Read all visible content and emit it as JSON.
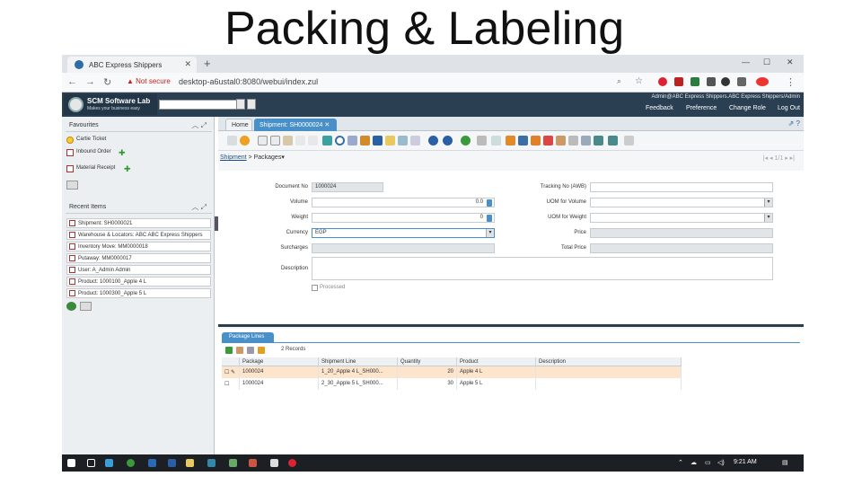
{
  "slide_title": "Packing & Labeling",
  "browser": {
    "tab_title": "ABC Express Shippers",
    "security_label": "Not secure",
    "url": "desktop-a6ustal0:8080/webui/index.zul",
    "colors": {
      "tabstrip": "#dfe3e7",
      "addrbar": "#f8f9fa",
      "warn": "#c5221f"
    }
  },
  "app": {
    "logo_name": "SCM Software Lab",
    "logo_tagline": "Makes your business easy",
    "user_line": "Admin@ABC Express Shippers.ABC Express Shippers/Admin",
    "header_links": [
      "Feedback",
      "Preference",
      "Change Role",
      "Log Out"
    ],
    "header_color": "#2a3f52",
    "accent": "#4a90c8"
  },
  "favourites": {
    "title": "Favourites",
    "items": [
      "Cartie Ticket",
      "Inbound Order",
      "Material Receipt"
    ]
  },
  "recent": {
    "title": "Recent Items",
    "items": [
      "Shipment: SH0000021",
      "Warehouse & Locators: ABC ABC Express Shippers",
      "Inventory Move: MM0000018",
      "Putaway: MM0000017",
      "User: A_Admin Admin",
      "Product: 1000100_Apple 4 L",
      "Product: 1000300_Apple 5 L"
    ]
  },
  "tabs": {
    "home": "Home",
    "active": "Shipment: SH0000024"
  },
  "breadcrumb": {
    "parent": "Shipment",
    "current": "Packages"
  },
  "pager": "1/1",
  "form": {
    "document_no": {
      "label": "Document No",
      "value": "1000024"
    },
    "volume": {
      "label": "Volume",
      "value": "0.0"
    },
    "weight": {
      "label": "Weight",
      "value": "0"
    },
    "currency": {
      "label": "Currency",
      "value": "EGP"
    },
    "surcharges": {
      "label": "Surcharges",
      "value": ""
    },
    "description": {
      "label": "Description",
      "value": ""
    },
    "processed": {
      "label": "Processed"
    },
    "tracking_no": {
      "label": "Tracking No (AWB)",
      "value": ""
    },
    "uom_volume": {
      "label": "UOM for Volume",
      "value": ""
    },
    "uom_weight": {
      "label": "UOM for Weight",
      "value": ""
    },
    "price": {
      "label": "Price",
      "value": ""
    },
    "total_price": {
      "label": "Total Price",
      "value": ""
    }
  },
  "package_lines": {
    "tab_title": "Package Lines",
    "records": "2 Records",
    "columns": [
      "Package",
      "Shipment Line",
      "Quantity",
      "Product",
      "Description"
    ],
    "rows": [
      {
        "package": "1000024",
        "shipment_line": "1_20_Apple 4 L_SH000...",
        "quantity": "20",
        "product": "Apple 4 L",
        "description": ""
      },
      {
        "package": "1000024",
        "shipment_line": "2_30_Apple 5 L_SH000...",
        "quantity": "30",
        "product": "Apple 5 L",
        "description": ""
      }
    ],
    "selected_row_color": "#fde4cc"
  },
  "taskbar": {
    "time": "9:21 AM"
  }
}
